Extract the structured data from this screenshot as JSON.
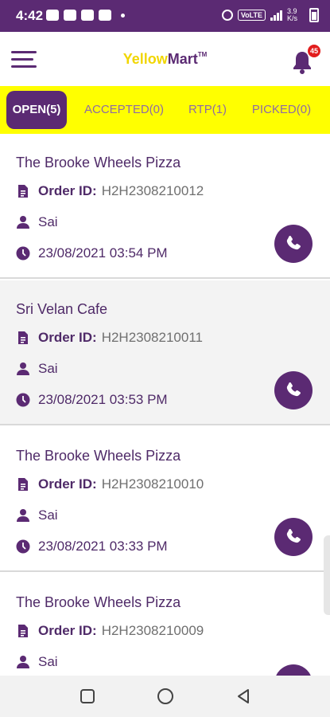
{
  "status": {
    "time": "4:42",
    "network": "VoLTE",
    "speed": "3.9 K/s"
  },
  "app": {
    "brand_left": "Yellow",
    "brand_right": "Mart",
    "trademark": "TM",
    "notifications": "45"
  },
  "tabs": [
    {
      "label": "OPEN(5)",
      "active": true
    },
    {
      "label": "ACCEPTED(0)",
      "active": false
    },
    {
      "label": "RTP(1)",
      "active": false
    },
    {
      "label": "PICKED(0)",
      "active": false
    }
  ],
  "labels": {
    "order_id": "Order ID:"
  },
  "orders": [
    {
      "store": "The Brooke Wheels Pizza",
      "order_id": "H2H2308210012",
      "customer": "Sai",
      "datetime": "23/08/2021  03:54 PM"
    },
    {
      "store": "Sri Velan Cafe",
      "order_id": "H2H2308210011",
      "customer": "Sai",
      "datetime": "23/08/2021  03:53 PM"
    },
    {
      "store": "The Brooke Wheels Pizza",
      "order_id": "H2H2308210010",
      "customer": "Sai",
      "datetime": "23/08/2021  03:33 PM"
    },
    {
      "store": "The Brooke Wheels Pizza",
      "order_id": "H2H2308210009",
      "customer": "Sai",
      "datetime": ""
    }
  ],
  "colors": {
    "primary": "#5b2a73",
    "tab_bar": "#ffff00",
    "brand_yellow": "#f1d600",
    "badge": "#e21d1d"
  }
}
